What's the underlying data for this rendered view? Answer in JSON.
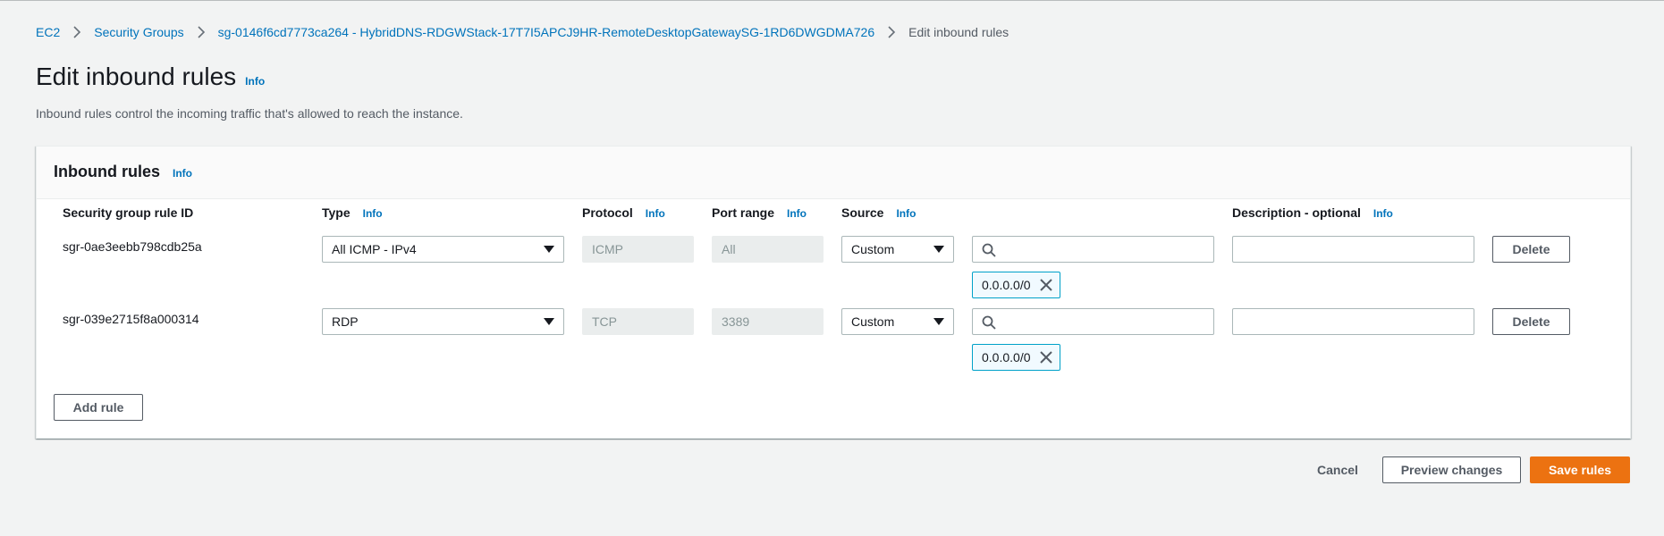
{
  "breadcrumb": {
    "items": [
      "EC2",
      "Security Groups",
      "sg-0146f6cd7773ca264 - HybridDNS-RDGWStack-17T7I5APCJ9HR-RemoteDesktopGatewaySG-1RD6DWGDMA726"
    ],
    "current": "Edit inbound rules"
  },
  "page": {
    "title": "Edit inbound rules",
    "info": "Info",
    "description": "Inbound rules control the incoming traffic that's allowed to reach the instance."
  },
  "panel": {
    "title": "Inbound rules",
    "info": "Info",
    "columns": {
      "rule_id": "Security group rule ID",
      "type": "Type",
      "protocol": "Protocol",
      "port_range": "Port range",
      "source": "Source",
      "description": "Description - optional",
      "info": "Info"
    },
    "rules": [
      {
        "id": "sgr-0ae3eebb798cdb25a",
        "type": "All ICMP - IPv4",
        "protocol": "ICMP",
        "port_range": "All",
        "source": "Custom",
        "cidr": "0.0.0.0/0",
        "delete_label": "Delete"
      },
      {
        "id": "sgr-039e2715f8a000314",
        "type": "RDP",
        "protocol": "TCP",
        "port_range": "3389",
        "source": "Custom",
        "cidr": "0.0.0.0/0",
        "delete_label": "Delete"
      }
    ],
    "add_rule_label": "Add rule"
  },
  "footer": {
    "cancel": "Cancel",
    "preview": "Preview changes",
    "save": "Save rules"
  },
  "colors": {
    "link": "#0073bb",
    "primary": "#ec7211",
    "token_border": "#00a1c9",
    "background": "#f2f3f3"
  },
  "icons": [
    "chevron-right-icon",
    "caret-down-icon",
    "search-icon",
    "close-icon"
  ]
}
